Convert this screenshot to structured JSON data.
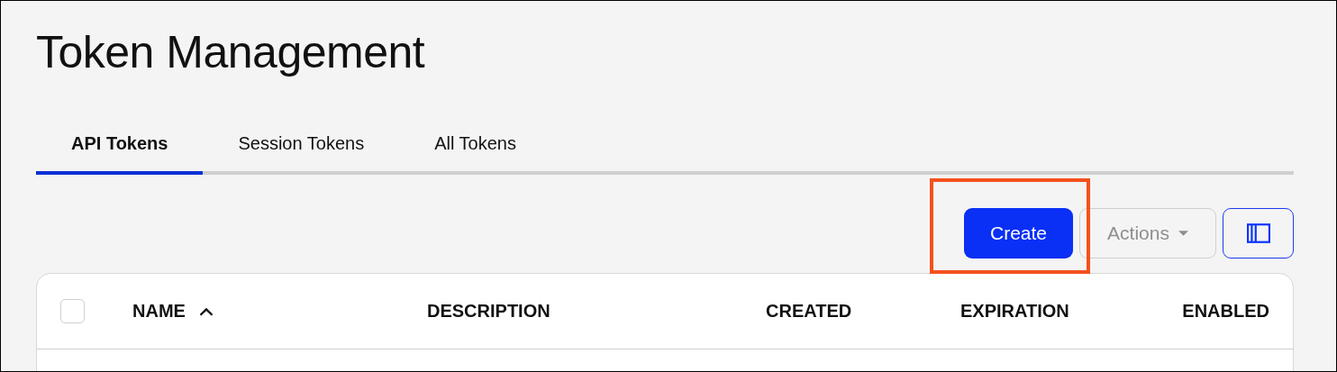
{
  "page": {
    "title": "Token Management"
  },
  "tabs": [
    {
      "label": "API Tokens",
      "selected": true
    },
    {
      "label": "Session Tokens",
      "selected": false
    },
    {
      "label": "All Tokens",
      "selected": false
    }
  ],
  "toolbar": {
    "create_button": {
      "label": "Create",
      "highlighted": true
    },
    "actions_button": {
      "label": "Actions",
      "disabled": true
    }
  },
  "table": {
    "select_all": {
      "checked": false
    },
    "columns": [
      {
        "label": "NAME",
        "sorted": true
      },
      {
        "label": "DESCRIPTION",
        "sorted": false
      },
      {
        "label": "CREATED",
        "sorted": false
      },
      {
        "label": "EXPIRATION",
        "sorted": false
      },
      {
        "label": "ENABLED",
        "sorted": false
      }
    ]
  }
}
